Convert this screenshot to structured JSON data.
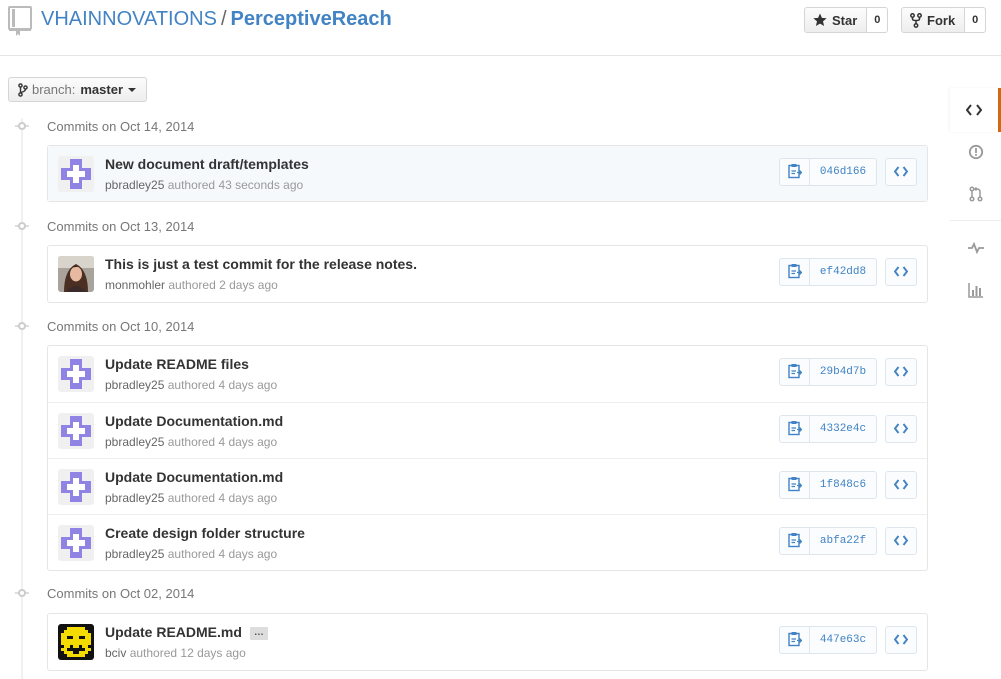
{
  "header": {
    "owner": "VHAINNOVATIONS",
    "separator": "/",
    "repo": "PerceptiveReach",
    "star_label": "Star",
    "star_count": "0",
    "fork_label": "Fork",
    "fork_count": "0"
  },
  "branch": {
    "label": "branch:",
    "value": "master"
  },
  "groups": [
    {
      "date": "Commits on Oct 14, 2014",
      "commits": [
        {
          "title": "New document draft/templates",
          "author": "pbradley25",
          "time": "authored 43 seconds ago",
          "sha": "046d166"
        }
      ]
    },
    {
      "date": "Commits on Oct 13, 2014",
      "commits": [
        {
          "title": "This is just a test commit for the release notes.",
          "author": "monmohler",
          "time": "authored 2 days ago",
          "sha": "ef42dd8"
        }
      ]
    },
    {
      "date": "Commits on Oct 10, 2014",
      "commits": [
        {
          "title": "Update README files",
          "author": "pbradley25",
          "time": "authored 4 days ago",
          "sha": "29b4d7b"
        },
        {
          "title": "Update Documentation.md",
          "author": "pbradley25",
          "time": "authored 4 days ago",
          "sha": "4332e4c"
        },
        {
          "title": "Update Documentation.md",
          "author": "pbradley25",
          "time": "authored 4 days ago",
          "sha": "1f848c6"
        },
        {
          "title": "Create design folder structure",
          "author": "pbradley25",
          "time": "authored 4 days ago",
          "sha": "abfa22f"
        }
      ]
    },
    {
      "date": "Commits on Oct 02, 2014",
      "commits": [
        {
          "title": "Update README.md",
          "ellipsis": "…",
          "author": "bciv",
          "time": "authored 12 days ago",
          "sha": "447e63c"
        }
      ]
    }
  ],
  "colors": {
    "link": "#4183c4",
    "identicon": "#8f83e4",
    "rail_accent": "#d26911",
    "highlight_row": "#f5f9fc"
  },
  "rail_icons": [
    "code-icon",
    "issues-icon",
    "pull-request-icon",
    "pulse-icon",
    "graphs-icon"
  ]
}
